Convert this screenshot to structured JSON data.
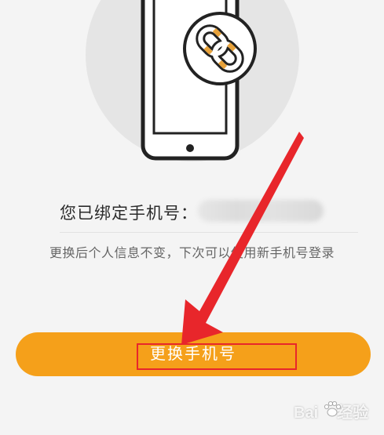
{
  "bound_label": "您已绑定手机号：",
  "hint": "更换后个人信息不变，下次可以使用新手机号登录",
  "change_button_label": "更换手机号",
  "watermark": {
    "lead": "Bai",
    "tail": "经验"
  },
  "colors": {
    "background": "#f4f4f4",
    "button": "#f5a01a",
    "annotation_red": "#e8262b",
    "chain_gold": "#e8a23a"
  },
  "icons": {
    "illustration": "phone-link-icon",
    "arrow": "red-arrow-annotation"
  }
}
